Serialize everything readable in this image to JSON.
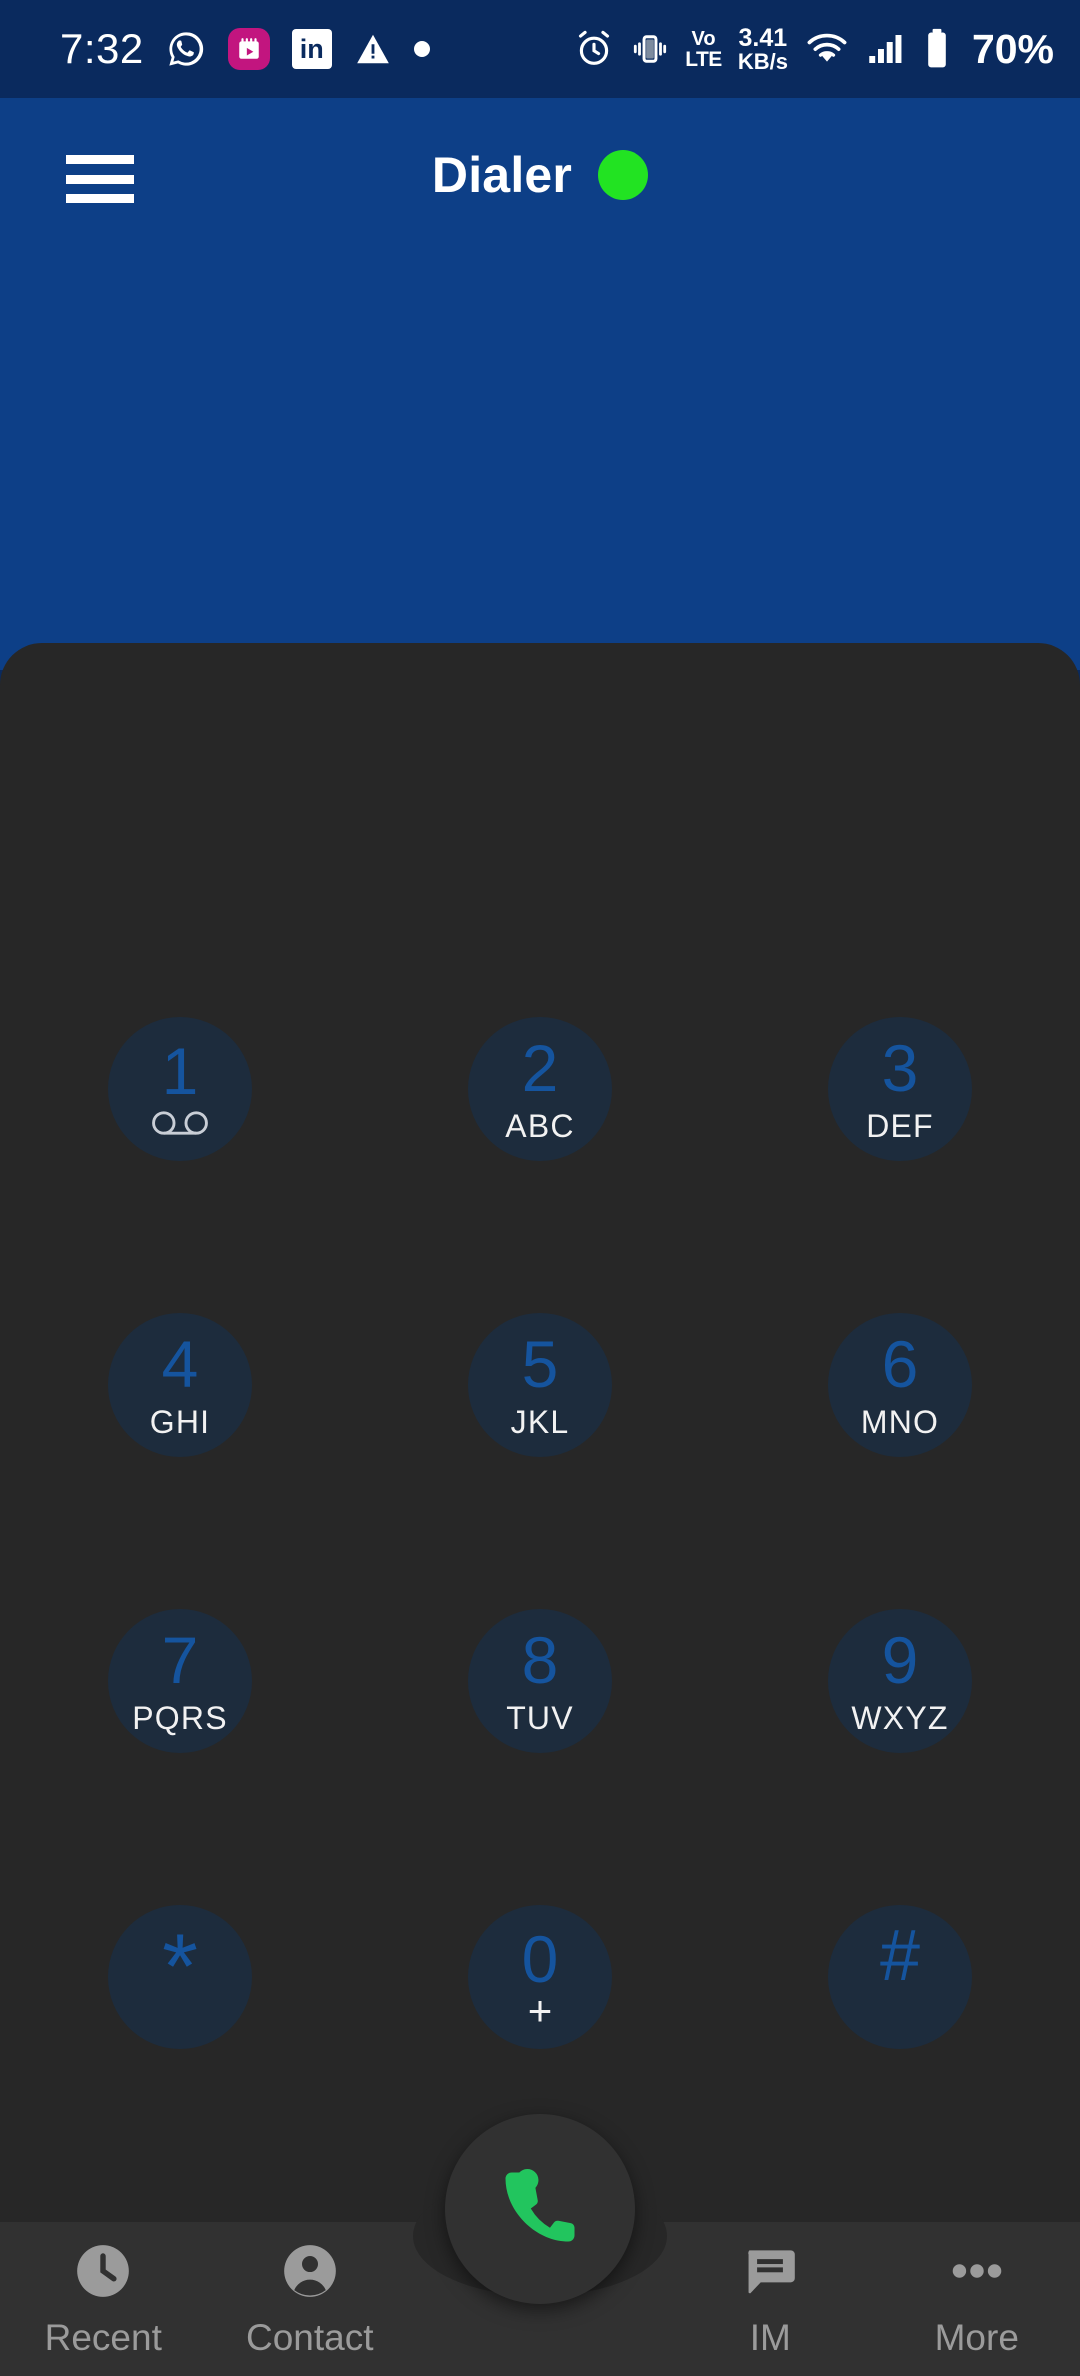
{
  "status_bar": {
    "time": "7:32",
    "left_icons": [
      {
        "name": "whatsapp-icon",
        "label": "WhatsApp"
      },
      {
        "name": "calendar-app-icon",
        "label": "Calendar",
        "color": "#c2157f"
      },
      {
        "name": "linkedin-icon",
        "label": "in"
      },
      {
        "name": "warning-triangle-icon",
        "label": "Warning"
      },
      {
        "name": "notification-dot-icon",
        "label": "Notification"
      }
    ],
    "right_icons": [
      {
        "name": "alarm-clock-icon",
        "label": "Alarm"
      },
      {
        "name": "vibrate-icon",
        "label": "Vibrate"
      },
      {
        "name": "volte-icon",
        "label_top": "Vo",
        "label_bottom": "LTE"
      }
    ],
    "network_speed": {
      "value": "3.41",
      "unit": "KB/s"
    },
    "wifi_icon": "wifi-icon",
    "signal_icon": "cellular-signal-icon",
    "battery_icon": "battery-icon",
    "battery_percent": "70%"
  },
  "app_bar": {
    "menu_icon": "hamburger-menu-icon",
    "title": "Dialer",
    "status_dot_label": "Online",
    "status_dot_color": "#22e322",
    "background_color": "#0d3f87"
  },
  "dialpad": {
    "digit_color": "#15549e",
    "letters_color": "#f2f2f2",
    "keys": [
      {
        "digit": "1",
        "letters": "",
        "icon": "voicemail-icon"
      },
      {
        "digit": "2",
        "letters": "ABC",
        "icon": ""
      },
      {
        "digit": "3",
        "letters": "DEF",
        "icon": ""
      },
      {
        "digit": "4",
        "letters": "GHI",
        "icon": ""
      },
      {
        "digit": "5",
        "letters": "JKL",
        "icon": ""
      },
      {
        "digit": "6",
        "letters": "MNO",
        "icon": ""
      },
      {
        "digit": "7",
        "letters": "PQRS",
        "icon": ""
      },
      {
        "digit": "8",
        "letters": "TUV",
        "icon": ""
      },
      {
        "digit": "9",
        "letters": "WXYZ",
        "icon": ""
      },
      {
        "digit": "*",
        "letters": "",
        "icon": ""
      },
      {
        "digit": "0",
        "letters": "+",
        "icon": ""
      },
      {
        "digit": "#",
        "letters": "",
        "icon": ""
      }
    ]
  },
  "call_button": {
    "icon": "phone-call-icon",
    "icon_color": "#22c55e",
    "label": "Call"
  },
  "bottom_nav": {
    "items": [
      {
        "label": "Recent",
        "icon": "clock-icon"
      },
      {
        "label": "Contact",
        "icon": "person-icon"
      },
      {
        "label": "IM",
        "icon": "message-icon"
      },
      {
        "label": "More",
        "icon": "more-dots-icon"
      }
    ],
    "label_color": "#9b9b9b"
  }
}
